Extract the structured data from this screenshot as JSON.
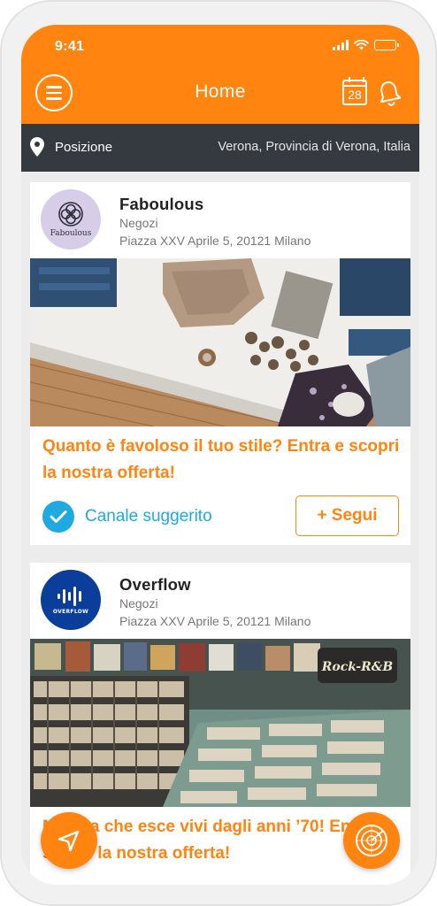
{
  "status_bar": {
    "time": "9:41"
  },
  "header": {
    "title": "Home",
    "calendar_day": "28"
  },
  "location": {
    "label": "Posizione",
    "value": "Verona, Provincia di Verona, Italia"
  },
  "posts": [
    {
      "shop_name": "Faboulous",
      "avatar_text": "Faboulous",
      "category": "Negozi",
      "address": "Piazza XXV Aprile 5, 20121 Milano",
      "offer": "Quanto è favoloso il tuo stile? Entra e scopri la nostra offerta!",
      "suggested_label": "Canale suggerito",
      "follow_label": "+ Segui"
    },
    {
      "shop_name": "Overflow",
      "avatar_text": "OVERFLOW",
      "category": "Negozi",
      "address": "Piazza XXV Aprile 5, 20121 Milano",
      "offer": "Musica che esce vivi dagli anni ’70! Entra e scopri la nostra offerta!",
      "store_sign": "Rock-R&B"
    }
  ],
  "colors": {
    "accent": "#ff8410",
    "location_bar": "#343a40",
    "suggested": "#1fa9e1"
  },
  "icons": {
    "menu": "menu-icon",
    "calendar": "calendar-icon",
    "bell": "bell-icon",
    "location": "location-pin-icon",
    "check": "check-icon",
    "navigate": "navigation-arrow-icon",
    "radar": "radar-icon"
  }
}
